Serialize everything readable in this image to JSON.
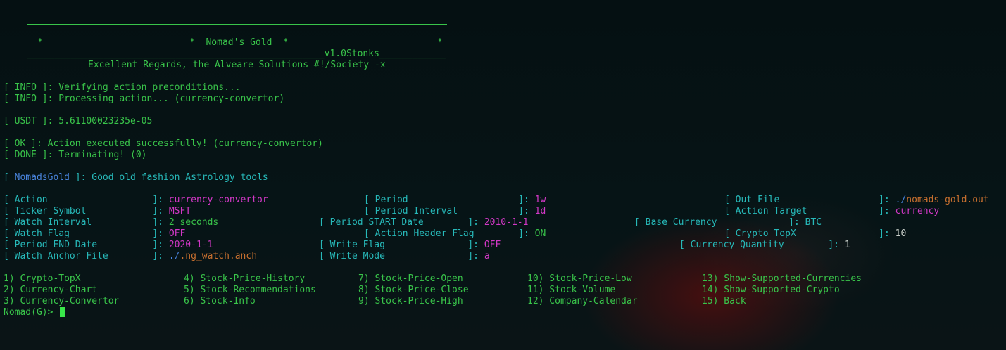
{
  "banner": {
    "star_left": "*",
    "title": "*  Nomad's Gold  *",
    "star_right": "*",
    "version_line": "______________________________________________________v1.0Stonks____________",
    "credits": "Excellent Regards, the Alveare Solutions #!/Society -x"
  },
  "log": {
    "info1": "[ INFO ]: Verifying action preconditions...",
    "info2": "[ INFO ]: Processing action... (currency-convertor)",
    "usdt": "[ USDT ]: 5.61100023235e-05",
    "ok": "[ OK ]: Action executed successfully! (currency-convertor)",
    "done": "[ DONE ]: Terminating! (0)",
    "header_open": "[ ",
    "header_name": "NomadsGold",
    "header_close": " ]: Good old fashion Astrology tools"
  },
  "settings": {
    "action": {
      "label": "[ Action                   ]: ",
      "value": "currency-convertor"
    },
    "ticker": {
      "label": "[ Ticker Symbol            ]: ",
      "value": "MSFT"
    },
    "watch_interval": {
      "label": "[ Watch Interval           ]: ",
      "value": "2 seconds"
    },
    "watch_flag": {
      "label": "[ Watch Flag               ]: ",
      "value": "OFF"
    },
    "period_end": {
      "label": "[ Period END Date          ]: ",
      "value": "2020-1-1"
    },
    "anchor_file": {
      "label": "[ Watch Anchor File        ]: ",
      "value_prefix": "./",
      "value": ".ng_watch.anch"
    },
    "period": {
      "label": "[ Period                    ]: ",
      "value": "1w"
    },
    "period_interval": {
      "label": "[ Period Interval           ]: ",
      "value": "1d"
    },
    "period_start": {
      "label": "[ Period START Date        ]: ",
      "value": "2010-1-1"
    },
    "action_header": {
      "label": "[ Action Header Flag        ]: ",
      "value": "ON"
    },
    "write_flag": {
      "label": "[ Write Flag               ]: ",
      "value": "OFF"
    },
    "write_mode": {
      "label": "[ Write Mode               ]: ",
      "value": "a"
    },
    "out_file": {
      "label": "[ Out File                  ]: ",
      "value_prefix": "./",
      "value": "nomads-gold.out"
    },
    "action_target": {
      "label": "[ Action Target             ]: ",
      "value": "currency"
    },
    "base_currency": {
      "label": "[ Base Currency             ]: ",
      "value": "BTC"
    },
    "crypto_topx": {
      "label": "[ Crypto TopX               ]: ",
      "value": "10"
    },
    "currency_quantity": {
      "label": "[ Currency Quantity        ]: ",
      "value": "1"
    }
  },
  "menu": [
    "1) Crypto-TopX",
    "2) Currency-Chart",
    "3) Currency-Convertor",
    "4) Stock-Price-History",
    "5) Stock-Recommendations",
    "6) Stock-Info",
    "7) Stock-Price-Open",
    "8) Stock-Price-Close",
    "9) Stock-Price-High",
    "10) Stock-Price-Low",
    "11) Stock-Volume",
    "12) Company-Calendar",
    "13) Show-Supported-Currencies",
    "14) Show-Supported-Crypto",
    "15) Back"
  ],
  "prompt": "Nomad(G)>"
}
